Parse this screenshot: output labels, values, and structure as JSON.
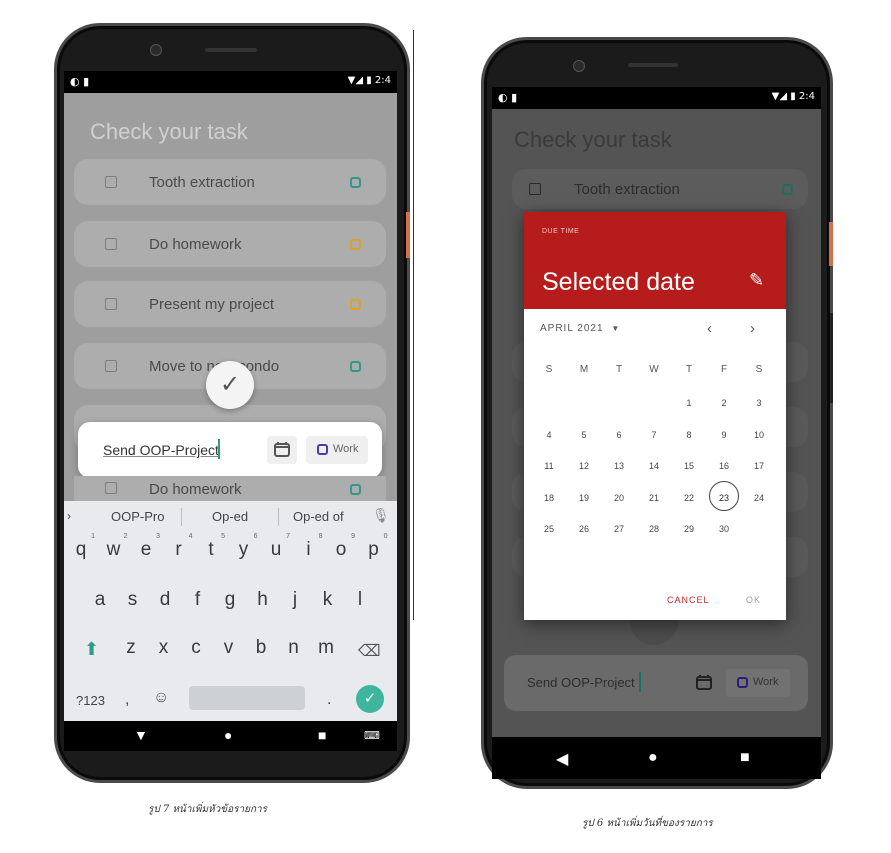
{
  "left_phone": {
    "status": {
      "left_icons": "◐ ▮",
      "right": "▼◢ ▮ 2:4"
    },
    "app_title": "Check your task",
    "tasks": [
      {
        "label": "Tooth extraction",
        "tag_color": "#2e9a8a"
      },
      {
        "label": "Do homework",
        "tag_color": "#e0a020"
      },
      {
        "label": "Present my project",
        "tag_color": "#e0a020"
      },
      {
        "label": "Move to new condo",
        "tag_color": "#2e9a8a"
      }
    ],
    "behind_task_label": "Do homework",
    "input": {
      "value": "Send OOP-Project",
      "category": "Work"
    },
    "keyboard": {
      "suggestions": [
        "OOP-Pro",
        "Op-ed",
        "Op-ed of"
      ],
      "row1": [
        "q",
        "w",
        "e",
        "r",
        "t",
        "y",
        "u",
        "i",
        "o",
        "p"
      ],
      "row1_nums": [
        "1",
        "2",
        "3",
        "4",
        "5",
        "6",
        "7",
        "8",
        "9",
        "0"
      ],
      "row2": [
        "a",
        "s",
        "d",
        "f",
        "g",
        "h",
        "j",
        "k",
        "l"
      ],
      "row3": [
        "z",
        "x",
        "c",
        "v",
        "b",
        "n",
        "m"
      ],
      "symbols_key": "?123",
      "comma_key": ",",
      "period_key": "."
    },
    "caption": "รูป 7 หน้าเพิ่มหัวข้อรายการ"
  },
  "right_phone": {
    "status": {
      "left_icons": "◐ ▮",
      "right": "▼◢ ▮ 2:4"
    },
    "app_title": "Check your task",
    "first_task": "Tooth extraction",
    "dialog": {
      "header_label": "DUE TIME",
      "header_title": "Selected date",
      "month_label": "APRIL 2021",
      "weekdays": [
        "S",
        "M",
        "T",
        "W",
        "T",
        "F",
        "S"
      ],
      "days": [
        [
          "",
          "",
          "",
          "",
          "1",
          "2",
          "3"
        ],
        [
          "4",
          "5",
          "6",
          "7",
          "8",
          "9",
          "10"
        ],
        [
          "11",
          "12",
          "13",
          "14",
          "15",
          "16",
          "17"
        ],
        [
          "18",
          "19",
          "20",
          "21",
          "22",
          "23",
          "24"
        ],
        [
          "25",
          "26",
          "27",
          "28",
          "29",
          "30",
          ""
        ]
      ],
      "selected_day": "23",
      "cancel_label": "CANCEL",
      "ok_label": "OK",
      "accent": "#c62828"
    },
    "input": {
      "value": "Send OOP-Project",
      "category": "Work"
    },
    "caption": "รูป 6 หน้าเพิ่มวันที่ของรายการ"
  },
  "colors": {
    "teal": "#2e9a8a",
    "orange": "#e0a020",
    "red": "#b71c1c",
    "check_green": "#3fb5a0"
  }
}
